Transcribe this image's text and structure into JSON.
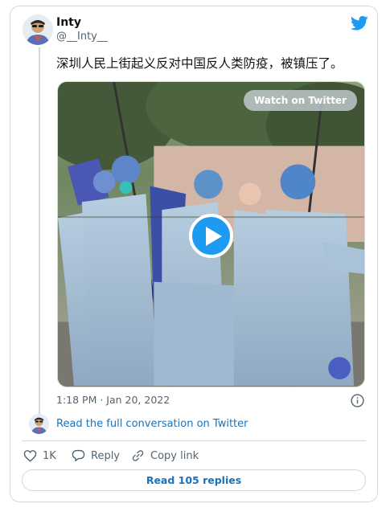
{
  "author": {
    "display_name": "Inty",
    "handle": "@__Inty__",
    "avatar_icon": "user-avatar-icon"
  },
  "brand": {
    "icon": "twitter-bird-icon",
    "color": "#1d9bf0"
  },
  "tweet": {
    "text": "深圳人民上街起义反对中国反人类防疫，被镇压了。",
    "timestamp": "1:18 PM · Jan 20, 2022"
  },
  "media": {
    "watch_label": "Watch on Twitter",
    "play_icon": "play-icon"
  },
  "conversation": {
    "read_full_label": "Read the full conversation on Twitter"
  },
  "actions": {
    "like_icon": "heart-icon",
    "like_count": "1K",
    "reply_icon": "reply-icon",
    "reply_label": "Reply",
    "copy_icon": "link-icon",
    "copy_label": "Copy link"
  },
  "footer": {
    "read_replies_label": "Read 105 replies"
  },
  "colors": {
    "link": "#1d71b8",
    "secondary_text": "#536471",
    "border": "#cfd9de"
  }
}
